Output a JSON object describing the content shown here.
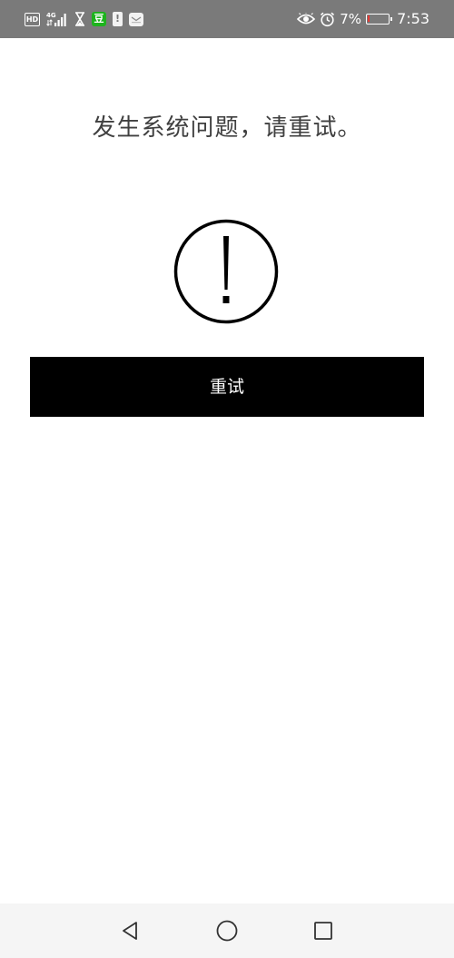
{
  "status_bar": {
    "hd_label": "HD",
    "network_label": "4G",
    "app_badge_green": "豆",
    "app_badge_alert": "!",
    "battery_percent": "7%",
    "battery_level": 0.07,
    "battery_color": "#e53935",
    "time": "7:53",
    "icons": [
      "hd-icon",
      "signal-icon",
      "hourglass-icon",
      "douban-app-icon",
      "alert-app-icon",
      "mail-icon",
      "eye-icon",
      "alarm-icon",
      "battery-icon"
    ]
  },
  "main": {
    "message": "发生系统问题，请重试。",
    "alert_icon": "exclamation-circle-icon",
    "retry_label": "重试"
  },
  "nav_bar": {
    "icons": [
      "back-icon",
      "home-icon",
      "recents-icon"
    ]
  },
  "colors": {
    "status_bar_bg": "#7a7a7a",
    "button_bg": "#000000",
    "button_text": "#ffffff",
    "message_text": "#404040",
    "nav_bar_bg": "#f5f5f5"
  }
}
